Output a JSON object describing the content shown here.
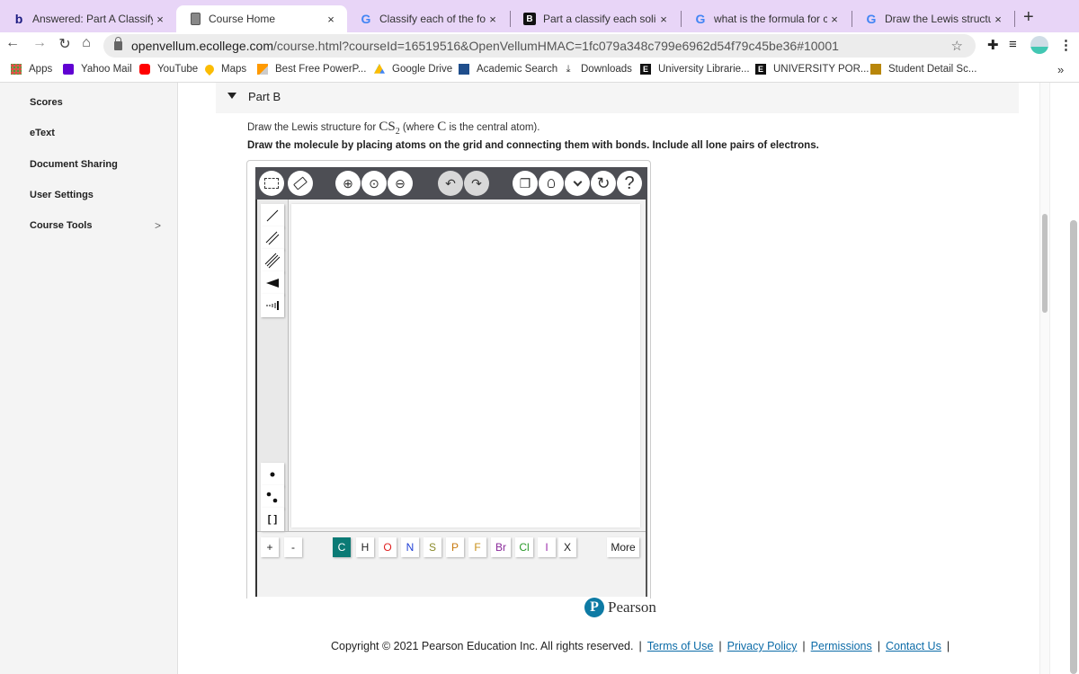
{
  "browser": {
    "tabs": [
      {
        "title": "Answered: Part A Classify ea",
        "icon": "bartleby-b-icon",
        "active": false
      },
      {
        "title": "Course Home",
        "icon": "page-icon",
        "active": true
      },
      {
        "title": "Classify each of the followin",
        "icon": "google-g-icon",
        "active": false
      },
      {
        "title": "Part a classify each solid as",
        "icon": "b-box-icon",
        "active": false
      },
      {
        "title": "what is the formula for cuso",
        "icon": "google-g-icon",
        "active": false
      },
      {
        "title": "Draw the Lewis structure for",
        "icon": "google-g-icon",
        "active": false
      }
    ],
    "new_tab": "+",
    "close_glyph": "×",
    "url_domain": "openvellum.ecollege.com",
    "url_path": "/course.html?courseId=16519516&OpenVellumHMAC=1fc079a348c799e6962d54f79c45be36#10001",
    "bookmarks": [
      {
        "label": "Apps",
        "icon": "apps-grid-icon"
      },
      {
        "label": "Yahoo Mail",
        "icon": "yahoo-mail-icon"
      },
      {
        "label": "YouTube",
        "icon": "youtube-icon"
      },
      {
        "label": "Maps",
        "icon": "maps-pin-icon"
      },
      {
        "label": "Best Free PowerP...",
        "icon": "powerpoint-bookmark-icon"
      },
      {
        "label": "Google Drive",
        "icon": "google-drive-icon"
      },
      {
        "label": "Academic Search",
        "icon": "academic-search-icon"
      },
      {
        "label": "Downloads",
        "icon": "download-icon"
      },
      {
        "label": "University Librarie...",
        "icon": "university-e-icon"
      },
      {
        "label": "UNIVERSITY POR...",
        "icon": "university-e-icon"
      },
      {
        "label": "Student Detail Sc...",
        "icon": "student-detail-icon"
      }
    ],
    "bookmarks_overflow": "»"
  },
  "sidebar": {
    "items": [
      {
        "label": "Scores"
      },
      {
        "label": "eText"
      },
      {
        "label": "Document Sharing"
      },
      {
        "label": "User Settings"
      },
      {
        "label": "Course Tools",
        "has_submenu": true
      }
    ],
    "chevron": ">"
  },
  "question": {
    "part_label": "Part B",
    "prompt_prefix": "Draw the Lewis structure for ",
    "prompt_formula": "CS",
    "prompt_formula_sub": "2",
    "prompt_mid": " (where ",
    "prompt_atom": "C",
    "prompt_suffix": " is the central atom).",
    "instruction": "Draw the molecule by placing atoms on the grid and connecting them with bonds. Include all lone pairs of electrons."
  },
  "editor": {
    "top_tools": [
      {
        "name": "select-tool",
        "glyph": "⬚"
      },
      {
        "name": "eraser-tool",
        "glyph": "⌫"
      },
      {
        "name": "zoom-in-tool",
        "glyph": "⊕"
      },
      {
        "name": "zoom-reset-tool",
        "glyph": "⊙"
      },
      {
        "name": "zoom-out-tool",
        "glyph": "⊖"
      },
      {
        "name": "undo-tool",
        "glyph": "↶"
      },
      {
        "name": "redo-tool",
        "glyph": "↷"
      },
      {
        "name": "templates-tool",
        "glyph": "❐"
      },
      {
        "name": "hint-tool",
        "glyph": "💡"
      },
      {
        "name": "more-tools-dropdown",
        "glyph": "⌄"
      },
      {
        "name": "reset-tool",
        "glyph": "↻"
      },
      {
        "name": "help-tool",
        "glyph": "?"
      }
    ],
    "left_tools": [
      {
        "name": "single-bond-tool"
      },
      {
        "name": "double-bond-tool"
      },
      {
        "name": "triple-bond-tool"
      },
      {
        "name": "wedge-bond-tool"
      },
      {
        "name": "hash-bond-tool"
      },
      {
        "name": "lone-electron-tool"
      },
      {
        "name": "lone-pair-tool"
      },
      {
        "name": "bracket-tool",
        "glyph": "[ ]"
      }
    ],
    "charge_buttons": [
      "+",
      "-"
    ],
    "atoms": [
      {
        "symbol": "C",
        "color": "#ffffff",
        "selected": true
      },
      {
        "symbol": "H",
        "color": "#222222"
      },
      {
        "symbol": "O",
        "color": "#e02020"
      },
      {
        "symbol": "N",
        "color": "#1f3fd6"
      },
      {
        "symbol": "S",
        "color": "#8a8a2a"
      },
      {
        "symbol": "P",
        "color": "#c87a10"
      },
      {
        "symbol": "F",
        "color": "#c8901a"
      },
      {
        "symbol": "Br",
        "color": "#8a2a9a"
      },
      {
        "symbol": "Cl",
        "color": "#2a9a2a"
      },
      {
        "symbol": "I",
        "color": "#9a2aaa"
      },
      {
        "symbol": "X",
        "color": "#222222"
      }
    ],
    "more_label": "More",
    "selected_atom_bg": "#0b7a75"
  },
  "footer": {
    "brand": "Pearson",
    "copyright": "Copyright © 2021 Pearson Education Inc. All rights reserved.",
    "links": [
      "Terms of Use",
      "Privacy Policy",
      "Permissions",
      "Contact Us"
    ],
    "separator": "|"
  }
}
